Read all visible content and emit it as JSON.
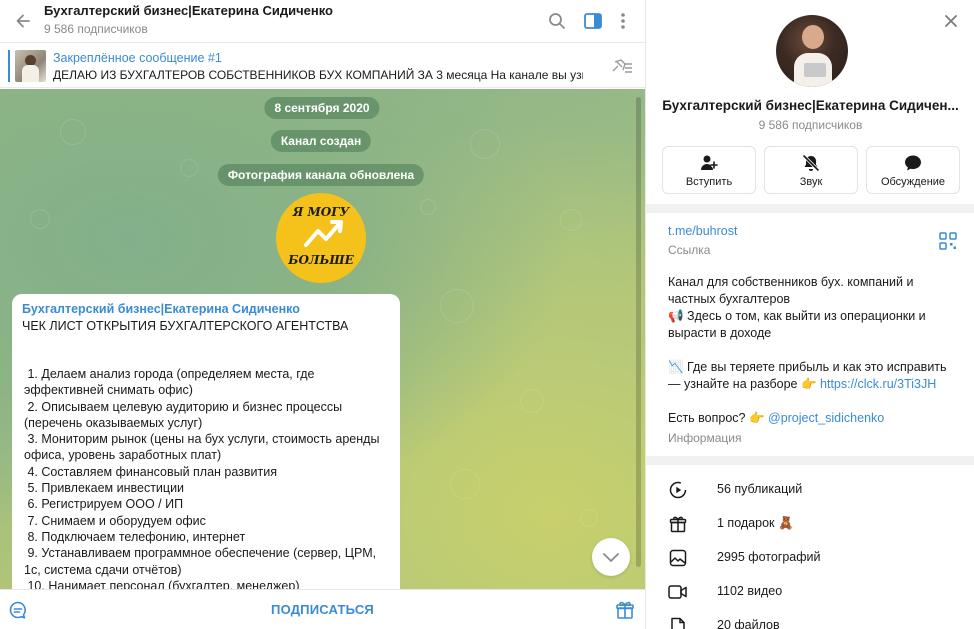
{
  "header": {
    "title": "Бухгалтерский бизнес|Екатерина Сидиченко",
    "subscribers": "9 586 подписчиков",
    "icons": [
      "back-arrow-icon",
      "search-icon",
      "sidebar-toggle-icon",
      "more-vertical-icon"
    ]
  },
  "pinned": {
    "title": "Закреплённое сообщение #1",
    "text": "ДЕЛАЮ ИЗ БУХГАЛТЕРОВ СОБСТВЕННИКОВ БУХ КОМПАНИЙ ЗА 3 месяца    На канале вы узна..."
  },
  "chat": {
    "service_messages": [
      "8 сентября 2020",
      "Канал создан",
      "Фотография канала обновлена"
    ],
    "photo_text_top": "Я МОГУ",
    "photo_text_bottom": "БОЛЬШЕ",
    "post": {
      "author": "Бухгалтерский бизнес|Екатерина Сидиченко",
      "heading": "ЧЕК ЛИСТ ОТКРЫТИЯ БУХГАЛТЕРСКОГО АГЕНТСТВА",
      "items": [
        " 1. Делаем анализ города (определяем места, где эффективней снимать офис)",
        " 2. Описываем целевую аудиторию и бизнес процессы (перечень оказываемых услуг)",
        " 3. Мониторим рынок (цены на бух услуги, стоимость аренды офиса, уровень заработных плат)",
        " 4. Составляем финансовый план развития",
        " 5. Привлекаем инвестиции",
        " 6. Регистрируем ООО / ИП",
        " 7. Снимаем и оборудуем офис",
        " 8. Подключаем телефонию, интернет",
        " 9. Устанавливаем программное обеспечение (сервер, ЦРМ, 1с, система сдачи отчётов)",
        " 10. Нанимает персонал (бухгалтер, менеджер)"
      ]
    }
  },
  "bottom": {
    "subscribe_label": "ПОДПИСАТЬСЯ"
  },
  "profile": {
    "title": "Бухгалтерский бизнес|Екатерина Сидичен...",
    "subscribers": "9 586 подписчиков",
    "buttons": [
      {
        "label": "Вступить",
        "icon": "join-icon"
      },
      {
        "label": "Звук",
        "icon": "mute-bell-icon"
      },
      {
        "label": "Обсуждение",
        "icon": "discussion-icon"
      }
    ],
    "link": "t.me/buhrost",
    "link_caption": "Ссылка",
    "description_lines": [
      {
        "text": "Канал для собственников бух. компаний  и частных бухгалтеров"
      },
      {
        "text": "📢 Здесь о том, как выйти из операционки и вырасти в доходе"
      },
      {
        "text": ""
      },
      {
        "text": "📉 Где вы теряете прибыль и как это исправить — узнайте на разборе 👉 ",
        "link": "https://clck.ru/3Ti3JH"
      },
      {
        "text": ""
      },
      {
        "text": "Есть вопрос? 👉 ",
        "link": "@project_sidichenko"
      }
    ],
    "info_caption": "Информация",
    "stats": [
      {
        "label": "56 публикаций",
        "icon": "posts-icon"
      },
      {
        "label": "1 подарок 🧸",
        "icon": "gift-icon"
      },
      {
        "label": "2995 фотографий",
        "icon": "photo-icon"
      },
      {
        "label": "1102 видео",
        "icon": "video-icon"
      },
      {
        "label": "20 файлов",
        "icon": "file-icon"
      }
    ]
  },
  "colors": {
    "accent": "#3a8bd6",
    "pill": "#4c7a56",
    "photo_yellow": "#f5c21c"
  }
}
